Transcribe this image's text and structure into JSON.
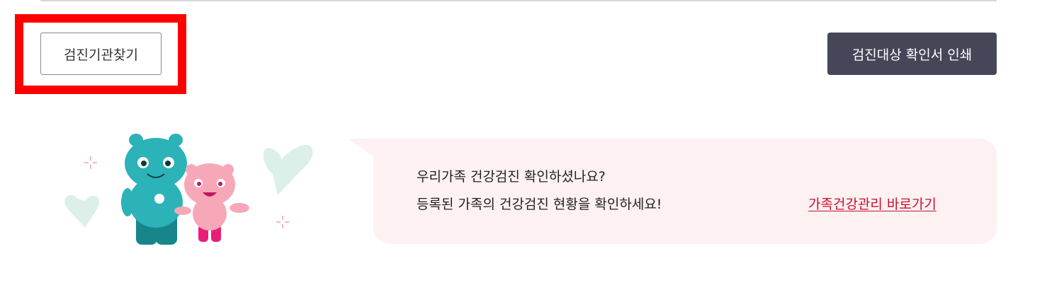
{
  "toolbar": {
    "find_clinic_label": "검진기관찾기",
    "print_certificate_label": "검진대상 확인서 인쇄"
  },
  "banner": {
    "line1": "우리가족 건강검진 확인하셨나요?",
    "line2": "등록된 가족의 건강검진 현황을 확인하세요!",
    "link_label": "가족건강관리 바로가기"
  },
  "colors": {
    "print_button_bg": "#454759",
    "highlight_border": "#ff0000",
    "bubble_bg": "#fdf1f2",
    "link_color": "#c8102e",
    "mascot_teal": "#2bb3b8",
    "mascot_pink": "#f7a8b8"
  },
  "icons": {
    "mascots": "family-mascots-illustration"
  }
}
